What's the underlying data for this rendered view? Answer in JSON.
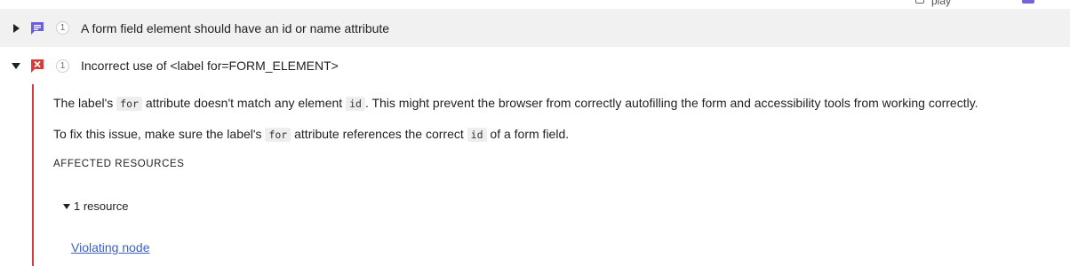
{
  "top_strip": {
    "partial_text": "play"
  },
  "issues": [
    {
      "expanded": false,
      "kind_icon": "message-icon",
      "count": "1",
      "title": "A form field element should have an id or name attribute"
    },
    {
      "expanded": true,
      "kind_icon": "error-icon",
      "count": "1",
      "title": "Incorrect use of <label for=FORM_ELEMENT>",
      "body": {
        "para1": {
          "t1": "The label's ",
          "c1": "for",
          "t2": " attribute doesn't match any element ",
          "c2": "id",
          "t3": ". This might prevent the browser from correctly autofilling the form and accessibility tools from working correctly."
        },
        "para2": {
          "t1": "To fix this issue, make sure the label's ",
          "c1": "for",
          "t2": " attribute references the correct ",
          "c2": "id",
          "t3": " of a form field."
        },
        "affected_label": "AFFECTED RESOURCES",
        "resource_count_label": "1 resource",
        "violating_link": "Violating node"
      }
    }
  ],
  "colors": {
    "collapsed_row_bg": "#f1f1f1",
    "message_icon": "#6b5fd8",
    "error_icon": "#d93a3a",
    "link": "#3c5fc2"
  }
}
